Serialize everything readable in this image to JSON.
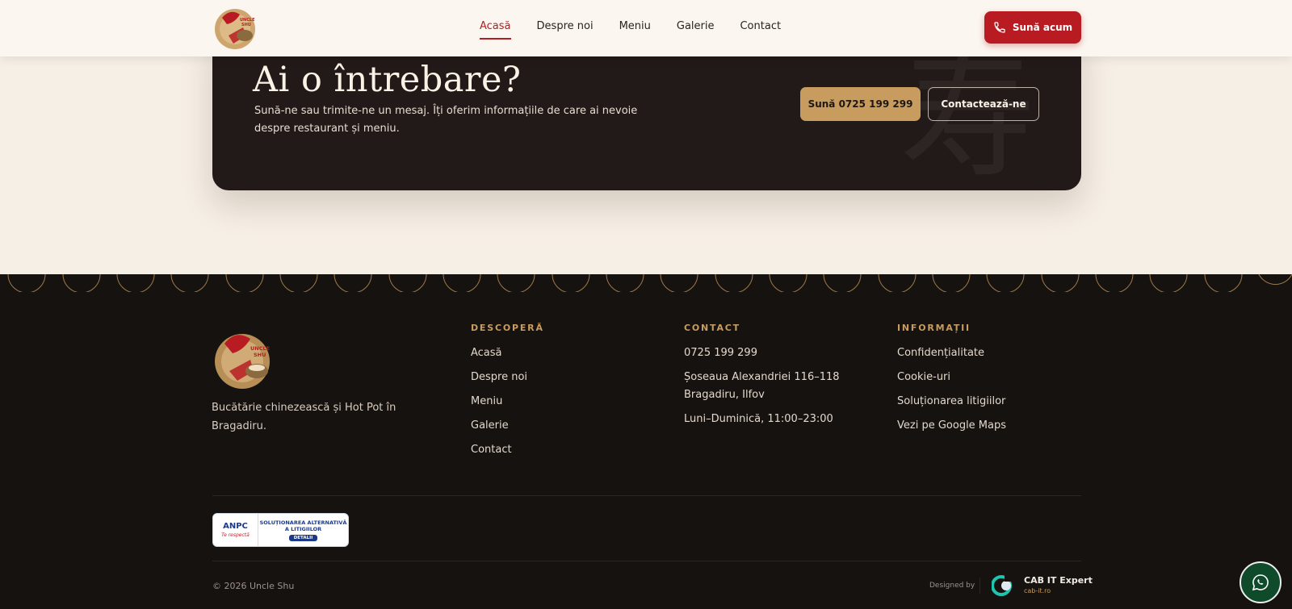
{
  "header": {
    "nav": [
      {
        "label": "Acasă",
        "active": true
      },
      {
        "label": "Despre noi",
        "active": false
      },
      {
        "label": "Meniu",
        "active": false
      },
      {
        "label": "Galerie",
        "active": false
      },
      {
        "label": "Contact",
        "active": false
      }
    ],
    "call_button": "Sună acum",
    "logo_text": "UNCLE SHU"
  },
  "cta": {
    "title": "Ai o întrebare?",
    "text": "Sună-ne sau trimite-ne un mesaj. Îți oferim informațiile de care ai nevoie despre restaurant și meniu.",
    "call_button": "Sună 0725 199 299",
    "contact_button": "Contactează-ne",
    "watermark": "寿"
  },
  "footer": {
    "description": "Bucătărie chinezească și Hot Pot în Bragadiru.",
    "discover": {
      "heading": "DESCOPERĂ",
      "items": [
        "Acasă",
        "Despre noi",
        "Meniu",
        "Galerie",
        "Contact"
      ]
    },
    "contact": {
      "heading": "CONTACT",
      "items": [
        "0725 199 299",
        "Șoseaua Alexandriei 116–118 Bragadiru, Ilfov",
        "Luni–Duminică, 11:00–23:00"
      ]
    },
    "info": {
      "heading": "INFORMAȚII",
      "items": [
        "Confidențialitate",
        "Cookie-uri",
        "Soluționarea litigiilor",
        "Vezi pe Google Maps"
      ]
    },
    "anpc": {
      "logo": "ANPC",
      "tagline": "Te respectă",
      "title": "SOLUȚIONAREA ALTERNATIVĂ A LITIGIILOR",
      "details": "DETALII"
    },
    "copyright": "© 2026 Uncle Shu",
    "designed_by": "Designed by",
    "designer_name": "CAB IT Expert",
    "designer_url": "cab-it.ro"
  },
  "colors": {
    "brand_red": "#b81c22",
    "gold": "#c89c5e",
    "dark": "#221a18",
    "footer_bg": "#161210"
  }
}
